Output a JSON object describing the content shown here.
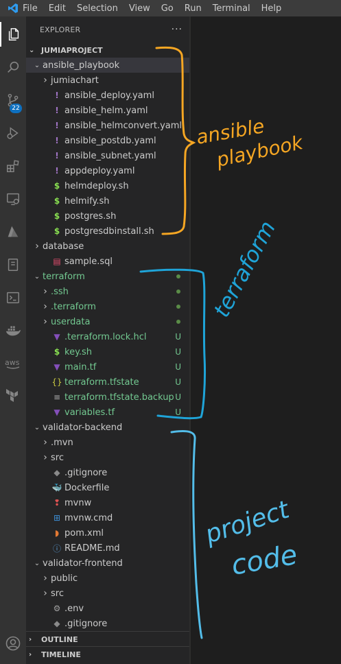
{
  "menubar": {
    "items": [
      "File",
      "Edit",
      "Selection",
      "View",
      "Go",
      "Run",
      "Terminal",
      "Help"
    ]
  },
  "activitybar": {
    "icons": [
      "explorer-icon",
      "search-icon",
      "source-control-icon",
      "run-debug-icon",
      "extensions-icon",
      "remote-explorer-icon",
      "azure-icon",
      "notebook-icon",
      "terminal-icon",
      "docker-icon",
      "aws-icon",
      "terraform-icon",
      "account-icon"
    ],
    "source_control_badge": "22"
  },
  "explorer": {
    "header": "EXPLORER",
    "more": "···",
    "project": "JUMIAPROJECT",
    "rows": [
      {
        "label": "ansible_playbook",
        "depth": 1,
        "type": "folder-open",
        "icon": "",
        "color": "#cccccc"
      },
      {
        "label": "jumiachart",
        "depth": 2,
        "type": "folder",
        "icon": "",
        "color": "#cccccc"
      },
      {
        "label": "ansible_deploy.yaml",
        "depth": 2,
        "type": "file",
        "icon": "!",
        "color": "#cccccc"
      },
      {
        "label": "ansible_helm.yaml",
        "depth": 2,
        "type": "file",
        "icon": "!",
        "color": "#cccccc"
      },
      {
        "label": "ansible_helmconvert.yaml",
        "depth": 2,
        "type": "file",
        "icon": "!",
        "color": "#cccccc"
      },
      {
        "label": "ansible_postdb.yaml",
        "depth": 2,
        "type": "file",
        "icon": "!",
        "color": "#cccccc"
      },
      {
        "label": "ansible_subnet.yaml",
        "depth": 2,
        "type": "file",
        "icon": "!",
        "color": "#cccccc"
      },
      {
        "label": "appdeploy.yaml",
        "depth": 2,
        "type": "file",
        "icon": "!",
        "color": "#cccccc"
      },
      {
        "label": "helmdeploy.sh",
        "depth": 2,
        "type": "file",
        "icon": "$",
        "color": "#cccccc"
      },
      {
        "label": "helmify.sh",
        "depth": 2,
        "type": "file",
        "icon": "$",
        "color": "#cccccc"
      },
      {
        "label": "postgres.sh",
        "depth": 2,
        "type": "file",
        "icon": "$",
        "color": "#cccccc"
      },
      {
        "label": "postgresdbinstall.sh",
        "depth": 2,
        "type": "file",
        "icon": "$",
        "color": "#cccccc"
      },
      {
        "label": "database",
        "depth": 1,
        "type": "folder",
        "icon": "",
        "color": "#cccccc"
      },
      {
        "label": "sample.sql",
        "depth": 2,
        "type": "file",
        "icon": "db",
        "color": "#cccccc"
      },
      {
        "label": "terraform",
        "depth": 1,
        "type": "folder-open",
        "icon": "",
        "color": "#73c991",
        "status": "dot"
      },
      {
        "label": ".ssh",
        "depth": 2,
        "type": "folder",
        "icon": "",
        "color": "#73c991",
        "status": "dot"
      },
      {
        "label": ".terraform",
        "depth": 2,
        "type": "folder",
        "icon": "",
        "color": "#73c991",
        "status": "dot"
      },
      {
        "label": "userdata",
        "depth": 2,
        "type": "folder",
        "icon": "",
        "color": "#73c991",
        "status": "dot"
      },
      {
        "label": ".terraform.lock.hcl",
        "depth": 2,
        "type": "file",
        "icon": "tf",
        "color": "#73c991",
        "status": "U"
      },
      {
        "label": "key.sh",
        "depth": 2,
        "type": "file",
        "icon": "$",
        "color": "#73c991",
        "status": "U"
      },
      {
        "label": "main.tf",
        "depth": 2,
        "type": "file",
        "icon": "tf",
        "color": "#73c991",
        "status": "U"
      },
      {
        "label": "terraform.tfstate",
        "depth": 2,
        "type": "file",
        "icon": "{}",
        "color": "#73c991",
        "status": "U"
      },
      {
        "label": "terraform.tfstate.backup",
        "depth": 2,
        "type": "file",
        "icon": "≡",
        "color": "#73c991",
        "status": "U"
      },
      {
        "label": "variables.tf",
        "depth": 2,
        "type": "file",
        "icon": "tf",
        "color": "#73c991",
        "status": "U"
      },
      {
        "label": "validator-backend",
        "depth": 1,
        "type": "folder-open",
        "icon": "",
        "color": "#cccccc"
      },
      {
        "label": ".mvn",
        "depth": 2,
        "type": "folder",
        "icon": "",
        "color": "#cccccc"
      },
      {
        "label": "src",
        "depth": 2,
        "type": "folder",
        "icon": "",
        "color": "#cccccc"
      },
      {
        "label": ".gitignore",
        "depth": 2,
        "type": "file",
        "icon": "git",
        "color": "#cccccc"
      },
      {
        "label": "Dockerfile",
        "depth": 2,
        "type": "file",
        "icon": "docker",
        "color": "#cccccc"
      },
      {
        "label": "mvnw",
        "depth": 2,
        "type": "file",
        "icon": "pin",
        "color": "#cccccc"
      },
      {
        "label": "mvnw.cmd",
        "depth": 2,
        "type": "file",
        "icon": "win",
        "color": "#cccccc"
      },
      {
        "label": "pom.xml",
        "depth": 2,
        "type": "file",
        "icon": "rss",
        "color": "#cccccc"
      },
      {
        "label": "README.md",
        "depth": 2,
        "type": "file",
        "icon": "info",
        "color": "#cccccc"
      },
      {
        "label": "validator-frontend",
        "depth": 1,
        "type": "folder-open",
        "icon": "",
        "color": "#cccccc"
      },
      {
        "label": "public",
        "depth": 2,
        "type": "folder",
        "icon": "",
        "color": "#cccccc"
      },
      {
        "label": "src",
        "depth": 2,
        "type": "folder",
        "icon": "",
        "color": "#cccccc"
      },
      {
        "label": ".env",
        "depth": 2,
        "type": "file",
        "icon": "gear",
        "color": "#cccccc"
      },
      {
        "label": ".gitignore",
        "depth": 2,
        "type": "file",
        "icon": "git",
        "color": "#cccccc"
      }
    ],
    "outline": "OUTLINE",
    "timeline": "TIMELINE"
  },
  "annotations": {
    "ansible_line1": "ansible",
    "ansible_line2": "playbook",
    "terraform": "terraform",
    "project_line1": "project",
    "project_line2": "code"
  },
  "colors": {
    "orange": "#f5a623",
    "blue": "#38b6e8",
    "git_green": "#73c991",
    "yaml": "#a074c4",
    "shell": "#89e051",
    "terraform": "#844fba",
    "json": "#cbcb41"
  }
}
